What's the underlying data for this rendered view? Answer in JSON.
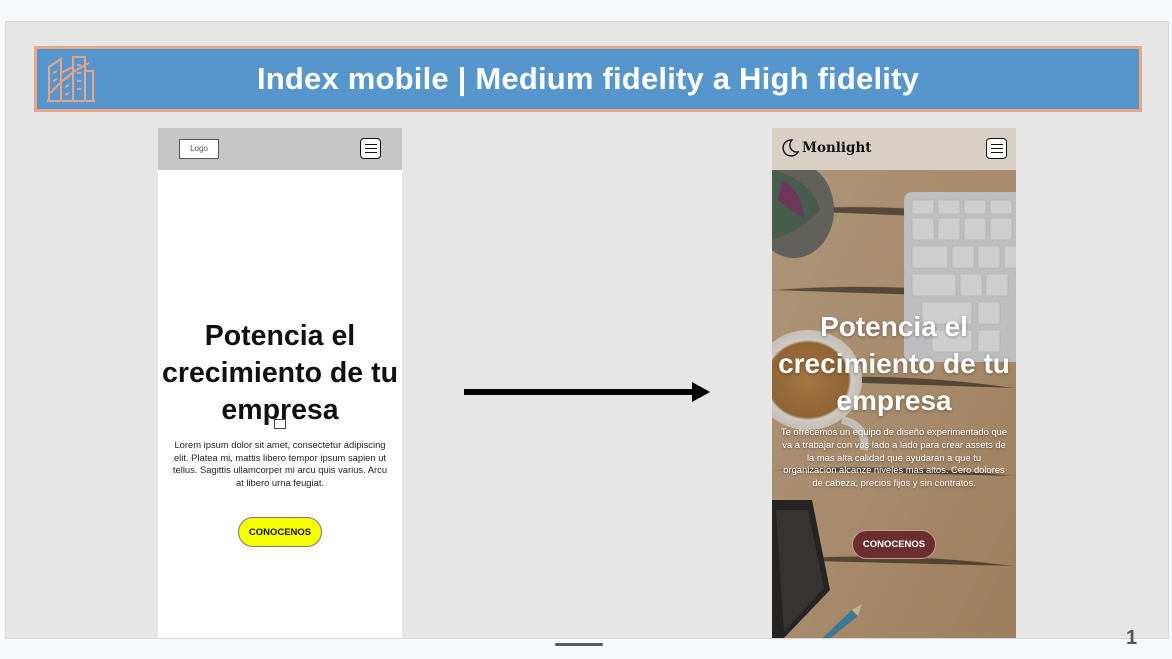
{
  "slide": {
    "title": "Index mobile | Medium fidelity a High fidelity",
    "page_number": "1"
  },
  "medium_fidelity": {
    "logo_label": "Logo",
    "heading": "Potencia el crecimiento de tu empresa",
    "body": "Lorem ipsum dolor sit amet, consectetur adipiscing elit. Platea mi, mattis libero tempor ipsum sapien ut tellus. Sagittis ullamcorper mi arcu quis varius. Arcu at libero urna feugiat.",
    "cta_label": "CONOCENOS",
    "cta_color": "#f7ff00"
  },
  "high_fidelity": {
    "brand_name": "Monlight",
    "heading": "Potencia el crecimiento de tu empresa",
    "body": "Te ofrecemos un equipo de diseño experimentado que va a trabajar con vos lado a lado para crear assets de la mas alta calidad que ayudaran a que tu organizacion alcanze niveles mas altos. Cero dolores de cabeza, precios fijos y sin contratos.",
    "cta_label": "CONOCENOS",
    "cta_color": "#6a2e2e"
  },
  "colors": {
    "banner": "#5696cc",
    "banner_border": "#e9a585",
    "slide_background": "#e6e6e6"
  },
  "icons": {
    "banner_logo": "city-buildings-icon",
    "menu": "hamburger-menu-icon",
    "brand": "crescent-moon-icon",
    "arrow": "right-arrow-icon"
  }
}
